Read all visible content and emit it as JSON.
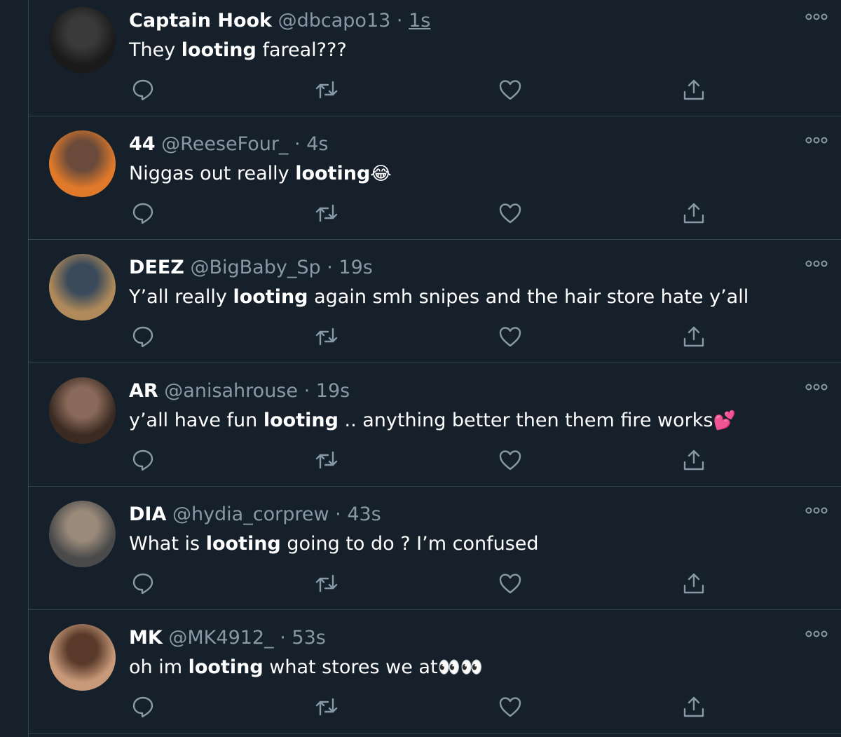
{
  "tweets": [
    {
      "name": "Captain Hook",
      "handle": "@dbcapo13",
      "separator": "·",
      "time": "1s",
      "time_linked": true,
      "text_before": "They ",
      "keyword": "looting",
      "text_after": " fareal???",
      "emoji": "",
      "avatar_colors": [
        "#1a1a1a",
        "#3a3a3a"
      ]
    },
    {
      "name": "44",
      "handle": "@ReeseFour_",
      "separator": "·",
      "time": "4s",
      "time_linked": false,
      "text_before": "Niggas out really ",
      "keyword": "looting",
      "text_after": "",
      "emoji": "😂",
      "avatar_colors": [
        "#e07a2a",
        "#6a4a3a"
      ]
    },
    {
      "name": "DEEZ",
      "handle": "@BigBaby_Sp",
      "separator": "·",
      "time": "19s",
      "time_linked": false,
      "text_before": "Y’all really ",
      "keyword": "looting",
      "text_after": " again smh snipes and the hair store hate y’all",
      "emoji": "",
      "avatar_colors": [
        "#b08a5a",
        "#3a4a5a"
      ]
    },
    {
      "name": "AR",
      "handle": "@anisahrouse",
      "separator": "·",
      "time": "19s",
      "time_linked": false,
      "text_before": "y’all have fun ",
      "keyword": "looting",
      "text_after": " .. anything better then them fire works",
      "emoji": "💕",
      "avatar_colors": [
        "#3a2a22",
        "#8a6a5a"
      ]
    },
    {
      "name": "DIA",
      "handle": "@hydia_corprew",
      "separator": "·",
      "time": "43s",
      "time_linked": false,
      "text_before": "What is ",
      "keyword": "looting",
      "text_after": " going to do ? I’m confused",
      "emoji": "",
      "avatar_colors": [
        "#4a4a4a",
        "#9a8a7a"
      ]
    },
    {
      "name": "MK",
      "handle": "@MK4912_",
      "separator": "·",
      "time": "53s",
      "time_linked": false,
      "text_before": "oh im ",
      "keyword": "looting",
      "text_after": " what stores we at",
      "emoji": "👀👀",
      "avatar_colors": [
        "#c89a7a",
        "#5a3a2a"
      ]
    }
  ],
  "colors": {
    "background": "#15202b",
    "border": "#38444d",
    "secondary_text": "#8899a6",
    "primary_text": "#ffffff"
  },
  "icons": [
    "reply-icon",
    "retweet-icon",
    "like-icon",
    "share-icon",
    "more-icon"
  ]
}
